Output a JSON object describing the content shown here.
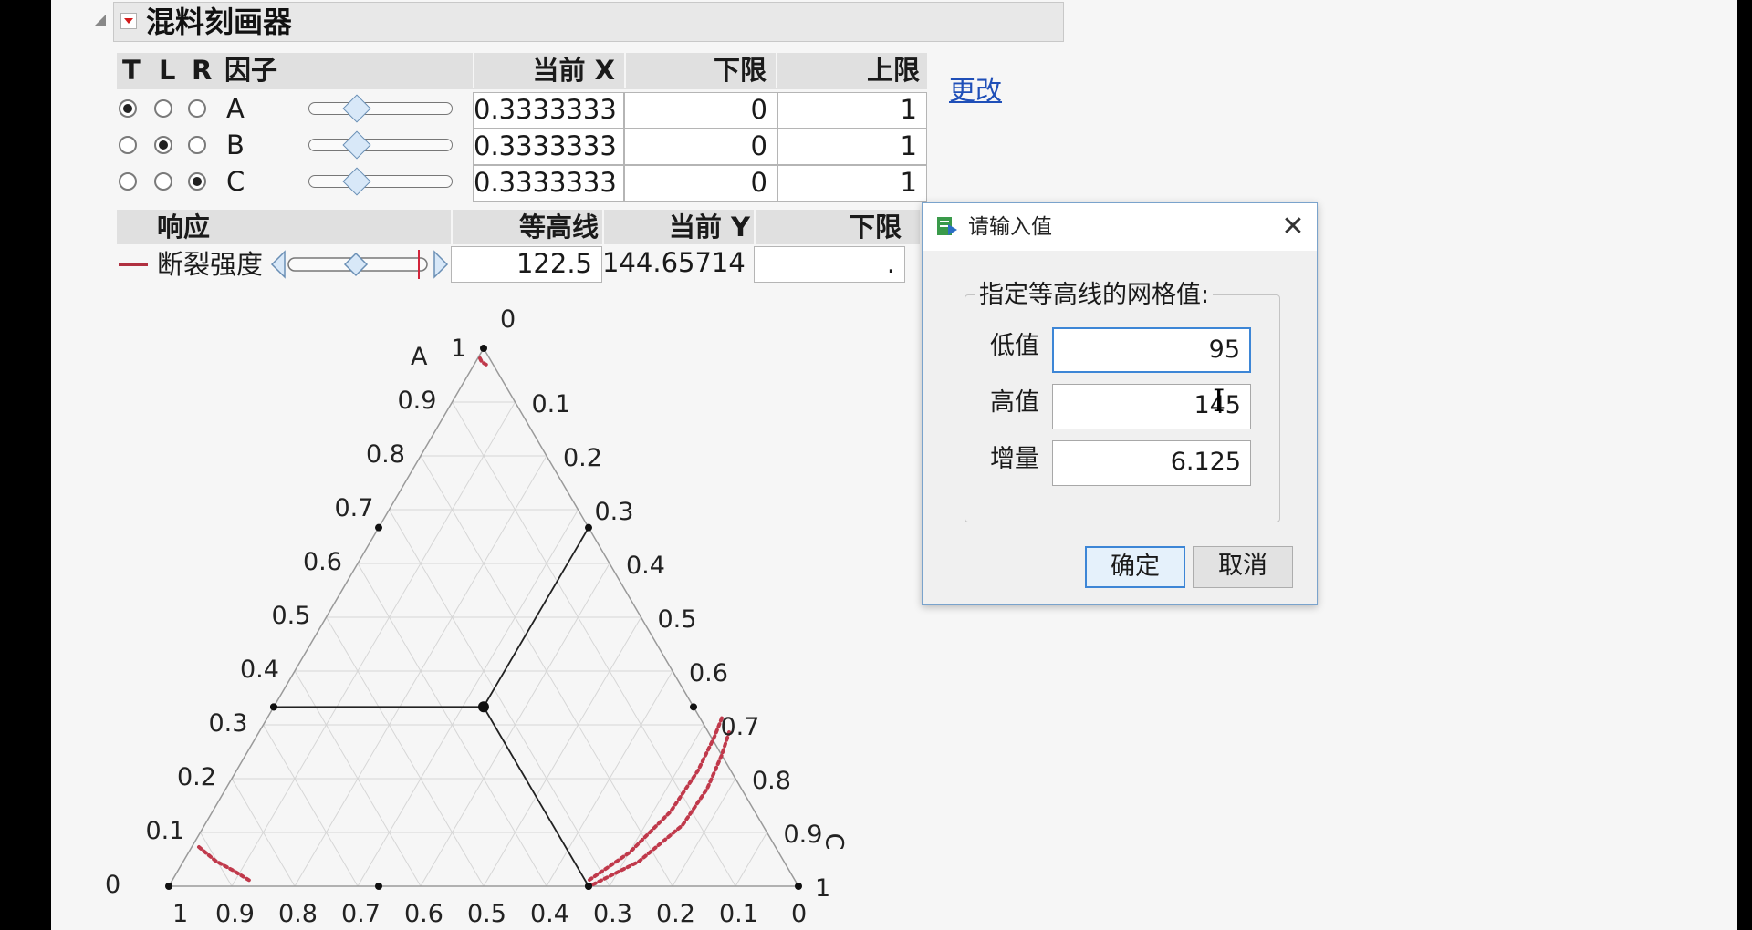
{
  "title": "混料刻画器",
  "factor_table": {
    "headers": {
      "t": "T",
      "l": "L",
      "r": "R",
      "factor": "因子",
      "current_x": "当前 X",
      "lower": "下限",
      "upper": "上限"
    },
    "rows": [
      {
        "name": "A",
        "current_x": "0.3333333",
        "lower": "0",
        "upper": "1",
        "radio": "T",
        "slider_fraction": 0.333
      },
      {
        "name": "B",
        "current_x": "0.3333333",
        "lower": "0",
        "upper": "1",
        "radio": "L",
        "slider_fraction": 0.333
      },
      {
        "name": "C",
        "current_x": "0.3333333",
        "lower": "0",
        "upper": "1",
        "radio": "R",
        "slider_fraction": 0.333
      }
    ],
    "change_link": "更改"
  },
  "response_table": {
    "headers": {
      "response": "响应",
      "contour": "等高线",
      "current_y": "当前 Y",
      "lower": "下限"
    },
    "rows": [
      {
        "name": "断裂强度",
        "contour": "122.5",
        "current_y": "144.65714",
        "lower": ".",
        "line_color": "#b03040"
      }
    ]
  },
  "ternary": {
    "apex_label": "A",
    "right_label": "C",
    "apex_value": "1",
    "left_ticks": [
      "0.9",
      "0.8",
      "0.7",
      "0.6",
      "0.5",
      "0.4",
      "0.3",
      "0.2",
      "0.1",
      "0"
    ],
    "right_ticks": [
      "0",
      "0.1",
      "0.2",
      "0.3",
      "0.4",
      "0.5",
      "0.6",
      "0.7",
      "0.8",
      "0.9",
      "1"
    ],
    "bottom_ticks": [
      "1",
      "0.9",
      "0.8",
      "0.7",
      "0.6",
      "0.5",
      "0.4",
      "0.3",
      "0.2",
      "0.1",
      "0"
    ],
    "current_point": {
      "A": 0.3333,
      "B": 0.3333,
      "C": 0.3333
    },
    "contour_color": "#c0394b",
    "grid_color": "#d6d6d6"
  },
  "dialog": {
    "title": "请输入值",
    "group_caption": "指定等高线的网格值:",
    "fields": [
      {
        "label": "低值",
        "value": "95"
      },
      {
        "label": "高值",
        "value": "145"
      },
      {
        "label": "增量",
        "value": "6.125"
      }
    ],
    "ok": "确定",
    "cancel": "取消",
    "close_glyph": "✕"
  }
}
